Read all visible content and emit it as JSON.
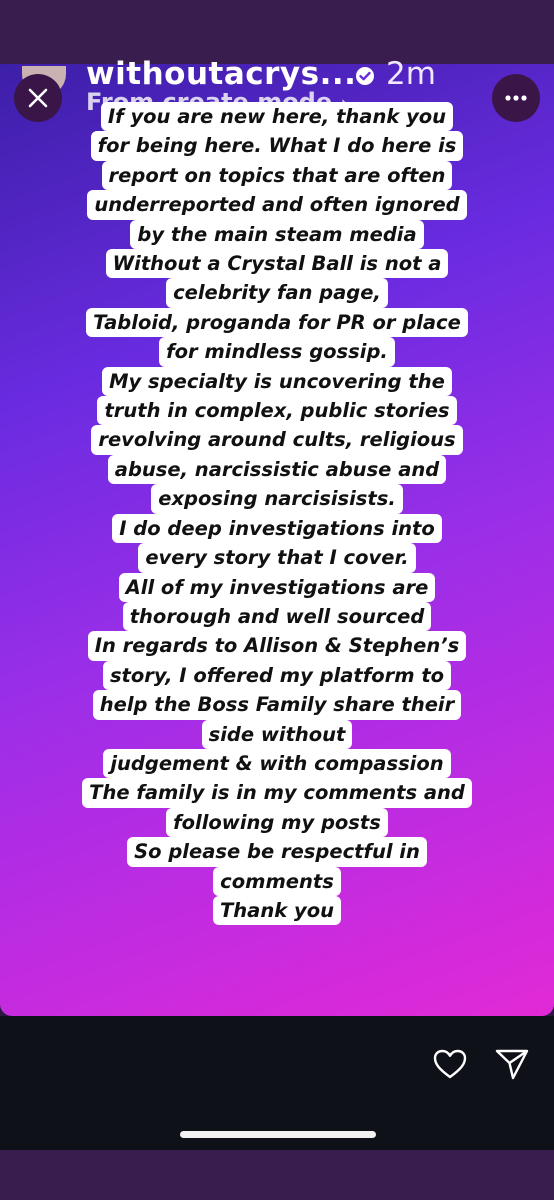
{
  "header": {
    "username": "withoutacrys...",
    "time": "2m",
    "subtitle": "From create mode",
    "subtitle_chevron": "›"
  },
  "story": {
    "lines": [
      "If you are new here, thank you",
      "for being here. What I do here is",
      "report on topics that are often",
      "underreported and often ignored",
      "by the main steam media",
      "Without a Crystal Ball is not a",
      "celebrity fan page,",
      "Tabloid, proganda for PR or place",
      "for mindless gossip.",
      "My specialty is uncovering the",
      "truth in complex, public stories",
      "revolving around cults, religious",
      "abuse, narcissistic abuse and",
      "exposing narcisisists.",
      "I do deep investigations into",
      "every story that I cover.",
      "All of my investigations are",
      "thorough and well sourced",
      "In regards to Allison & Stephen’s",
      "story, I offered my platform to",
      "help the Boss Family share their",
      "side without",
      "judgement & with compassion",
      "The family is in my comments and",
      "following my posts",
      "So please be respectful in",
      "comments",
      "Thank you"
    ]
  },
  "icons": {
    "close": "close-icon",
    "more": "more-icon",
    "verified": "verified-badge-icon",
    "like": "heart-icon",
    "share": "send-icon"
  },
  "colors": {
    "gradient_start": "#3c1fa8",
    "gradient_end": "#e22ad6",
    "text_bg": "#ffffff"
  }
}
